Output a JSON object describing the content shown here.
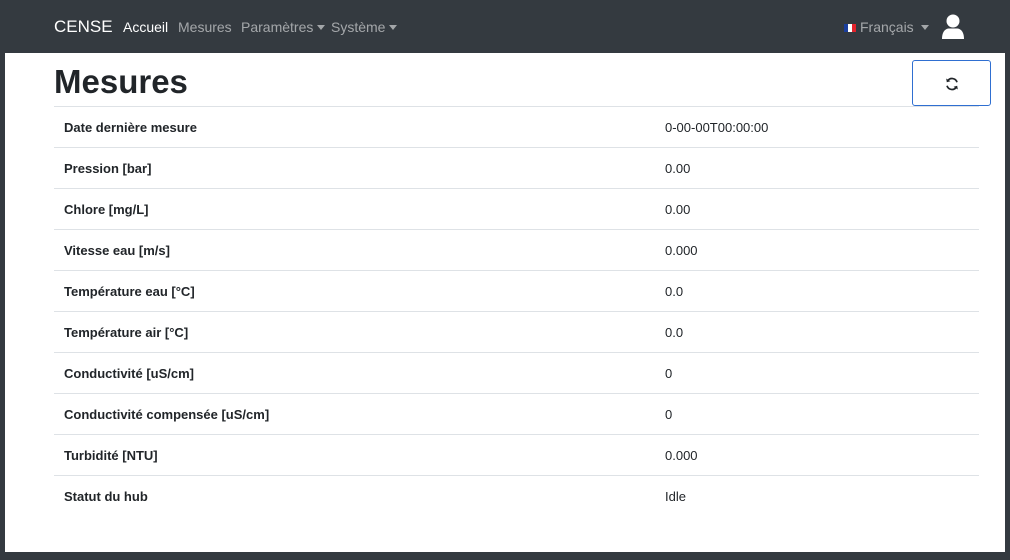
{
  "navbar": {
    "brand": "CENSE",
    "items": [
      {
        "label": "Accueil"
      },
      {
        "label": "Mesures"
      },
      {
        "label": "Paramètres"
      },
      {
        "label": "Système"
      }
    ],
    "language": "Français",
    "icons": {
      "flag": "flag-fr-icon",
      "user": "user-icon",
      "caret": "caret-down-icon"
    }
  },
  "main": {
    "title": "Mesures",
    "refresh_icon": "refresh-icon",
    "rows": [
      {
        "label": "Date dernière mesure",
        "value": "0-00-00T00:00:00"
      },
      {
        "label": "Pression [bar]",
        "value": "0.00"
      },
      {
        "label": "Chlore [mg/L]",
        "value": "0.00"
      },
      {
        "label": "Vitesse eau [m/s]",
        "value": "0.000"
      },
      {
        "label": "Température eau [°C]",
        "value": "0.0"
      },
      {
        "label": "Température air [°C]",
        "value": "0.0"
      },
      {
        "label": "Conductivité [uS/cm]",
        "value": "0"
      },
      {
        "label": "Conductivité compensée [uS/cm]",
        "value": "0"
      },
      {
        "label": "Turbidité [NTU]",
        "value": "0.000"
      },
      {
        "label": "Statut du hub",
        "value": "Idle"
      }
    ]
  },
  "colors": {
    "navbar_bg": "#343a40",
    "nav_active": "#ffffff",
    "nav_inactive": "#9a9da0",
    "button_border": "#2f6fd1",
    "table_border": "#dee2e6",
    "text": "#212529"
  }
}
